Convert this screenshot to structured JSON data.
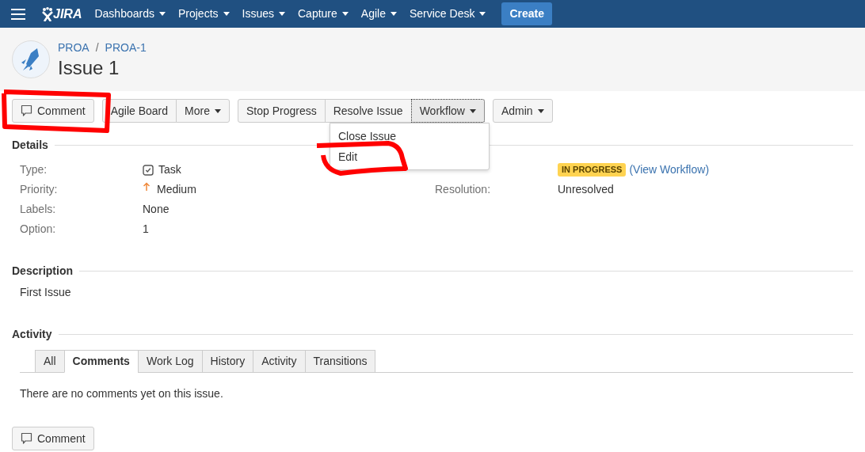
{
  "nav": {
    "logo": "JIRA",
    "menus": [
      "Dashboards",
      "Projects",
      "Issues",
      "Capture",
      "Agile",
      "Service Desk"
    ],
    "create": "Create"
  },
  "breadcrumbs": {
    "items": [
      "PROA",
      "PROA-1"
    ],
    "separator": "/"
  },
  "title": "Issue 1",
  "toolbar": [
    {
      "buttons": [
        {
          "label": "Comment",
          "kind": "comment",
          "selected": false
        }
      ]
    },
    {
      "buttons": [
        {
          "label": "Agile Board",
          "kind": "plain",
          "selected": false
        },
        {
          "label": "More",
          "kind": "dropdown",
          "selected": false
        }
      ]
    },
    {
      "buttons": [
        {
          "label": "Stop Progress",
          "kind": "plain",
          "selected": false
        },
        {
          "label": "Resolve Issue",
          "kind": "plain",
          "selected": false
        },
        {
          "label": "Workflow",
          "kind": "dropdown",
          "selected": true
        }
      ]
    },
    {
      "buttons": [
        {
          "label": "Admin",
          "kind": "dropdown",
          "selected": false
        }
      ]
    }
  ],
  "workflow_menu": {
    "items": [
      "Close Issue",
      "Edit"
    ]
  },
  "details": {
    "heading": "Details",
    "left": [
      {
        "label": "Type:",
        "value": "Task",
        "kind": "task"
      },
      {
        "label": "Priority:",
        "value": "Medium",
        "kind": "priority"
      },
      {
        "label": "Labels:",
        "value": "None",
        "kind": "plain"
      },
      {
        "label": "Option:",
        "value": "1",
        "kind": "plain"
      }
    ],
    "right": [
      {
        "kind": "status",
        "badge": "IN PROGRESS",
        "prefix": "(",
        "link": "View Workflow",
        "suffix": ")"
      },
      {
        "label": "Resolution:",
        "kind": "plain",
        "value": "Unresolved"
      }
    ]
  },
  "description": {
    "heading": "Description",
    "text": "First Issue"
  },
  "activity": {
    "heading": "Activity",
    "tabs": [
      {
        "label": "All",
        "selected": false
      },
      {
        "label": "Comments",
        "selected": true
      },
      {
        "label": "Work Log",
        "selected": false
      },
      {
        "label": "History",
        "selected": false
      },
      {
        "label": "Activity",
        "selected": false
      },
      {
        "label": "Transitions",
        "selected": false
      }
    ],
    "message": "There are no comments yet on this issue.",
    "comment_button": "Comment"
  }
}
